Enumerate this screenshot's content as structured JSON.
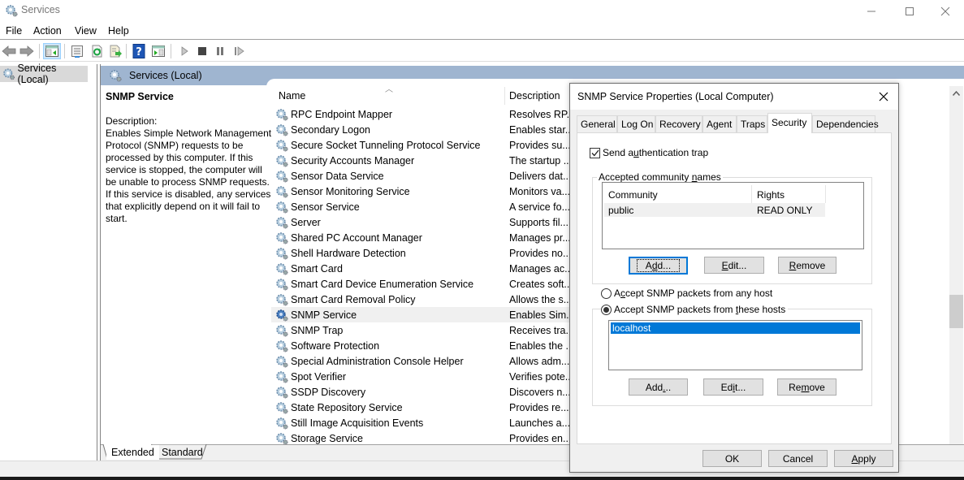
{
  "window": {
    "title": "Services",
    "controls": {
      "minimize": "—",
      "maximize": "☐",
      "close": "✕"
    }
  },
  "menu": [
    "File",
    "Action",
    "View",
    "Help"
  ],
  "toolbar": {
    "icons": [
      "back-icon",
      "forward-icon",
      "show-hide-console-tree-icon",
      "properties-icon",
      "refresh-icon",
      "export-list-icon",
      "help-icon",
      "show-action-pane-icon",
      "start-service-icon",
      "stop-service-icon",
      "pause-service-icon",
      "resume-service-icon"
    ]
  },
  "tree": {
    "root": "Services (Local)"
  },
  "pane": {
    "header": "Services (Local)",
    "selected_service": "SNMP Service",
    "description_label": "Description:",
    "description": "Enables Simple Network Management Protocol (SNMP) requests to be processed by this computer. If this service is stopped, the computer will be unable to process SNMP requests. If this service is disabled, any services that explicitly depend on it will fail to start.",
    "columns": {
      "name": "Name",
      "description": "Description"
    },
    "services": [
      {
        "name": "RPC Endpoint Mapper",
        "description": "Resolves RP..."
      },
      {
        "name": "Secondary Logon",
        "description": "Enables star..."
      },
      {
        "name": "Secure Socket Tunneling Protocol Service",
        "description": "Provides su..."
      },
      {
        "name": "Security Accounts Manager",
        "description": "The startup ..."
      },
      {
        "name": "Sensor Data Service",
        "description": "Delivers dat..."
      },
      {
        "name": "Sensor Monitoring Service",
        "description": "Monitors va..."
      },
      {
        "name": "Sensor Service",
        "description": "A service fo..."
      },
      {
        "name": "Server",
        "description": "Supports fil..."
      },
      {
        "name": "Shared PC Account Manager",
        "description": "Manages pr..."
      },
      {
        "name": "Shell Hardware Detection",
        "description": "Provides no..."
      },
      {
        "name": "Smart Card",
        "description": "Manages ac..."
      },
      {
        "name": "Smart Card Device Enumeration Service",
        "description": "Creates soft..."
      },
      {
        "name": "Smart Card Removal Policy",
        "description": "Allows the s..."
      },
      {
        "name": "SNMP Service",
        "description": "Enables Sim...",
        "selected": true
      },
      {
        "name": "SNMP Trap",
        "description": "Receives tra..."
      },
      {
        "name": "Software Protection",
        "description": "Enables the ..."
      },
      {
        "name": "Special Administration Console Helper",
        "description": "Allows adm..."
      },
      {
        "name": "Spot Verifier",
        "description": "Verifies pote..."
      },
      {
        "name": "SSDP Discovery",
        "description": "Discovers n..."
      },
      {
        "name": "State Repository Service",
        "description": "Provides re..."
      },
      {
        "name": "Still Image Acquisition Events",
        "description": "Launches a..."
      },
      {
        "name": "Storage Service",
        "description": "Provides en..."
      }
    ],
    "view_tabs": [
      "Extended",
      "Standard"
    ],
    "active_view_tab": "Extended"
  },
  "dialog": {
    "title": "SNMP Service Properties (Local Computer)",
    "tabs": [
      "General",
      "Log On",
      "Recovery",
      "Agent",
      "Traps",
      "Security",
      "Dependencies"
    ],
    "active_tab": "Security",
    "send_auth_trap": {
      "label_pre": "Send a",
      "label_u": "u",
      "label_post": "thentication trap",
      "checked": true
    },
    "community_group": {
      "label_pre": "Accepted community ",
      "label_u": "n",
      "label_post": "ames",
      "columns": [
        "Community",
        "Rights"
      ],
      "rows": [
        {
          "community": "public",
          "rights": "READ ONLY"
        }
      ],
      "buttons": {
        "add": {
          "pre": "A",
          "u": "d",
          "post": "d..."
        },
        "edit": {
          "pre": "",
          "u": "E",
          "post": "dit..."
        },
        "remove": {
          "pre": "",
          "u": "R",
          "post": "emove"
        }
      }
    },
    "accept_any": {
      "pre": "A",
      "u": "c",
      "post": "cept SNMP packets from any host",
      "selected": false
    },
    "accept_these": {
      "pre": "Accept SNMP packets from ",
      "u": "t",
      "post": "hese hosts",
      "selected": true
    },
    "hosts": [
      "localhost"
    ],
    "host_buttons": {
      "add": {
        "pre": "Add",
        "u": ".",
        "post": ".."
      },
      "edit": {
        "pre": "Ed",
        "u": "i",
        "post": "t..."
      },
      "remove": {
        "pre": "Re",
        "u": "m",
        "post": "ove"
      }
    },
    "footer": {
      "ok": "OK",
      "cancel": "Cancel",
      "apply": {
        "u": "A",
        "post": "pply"
      }
    }
  }
}
